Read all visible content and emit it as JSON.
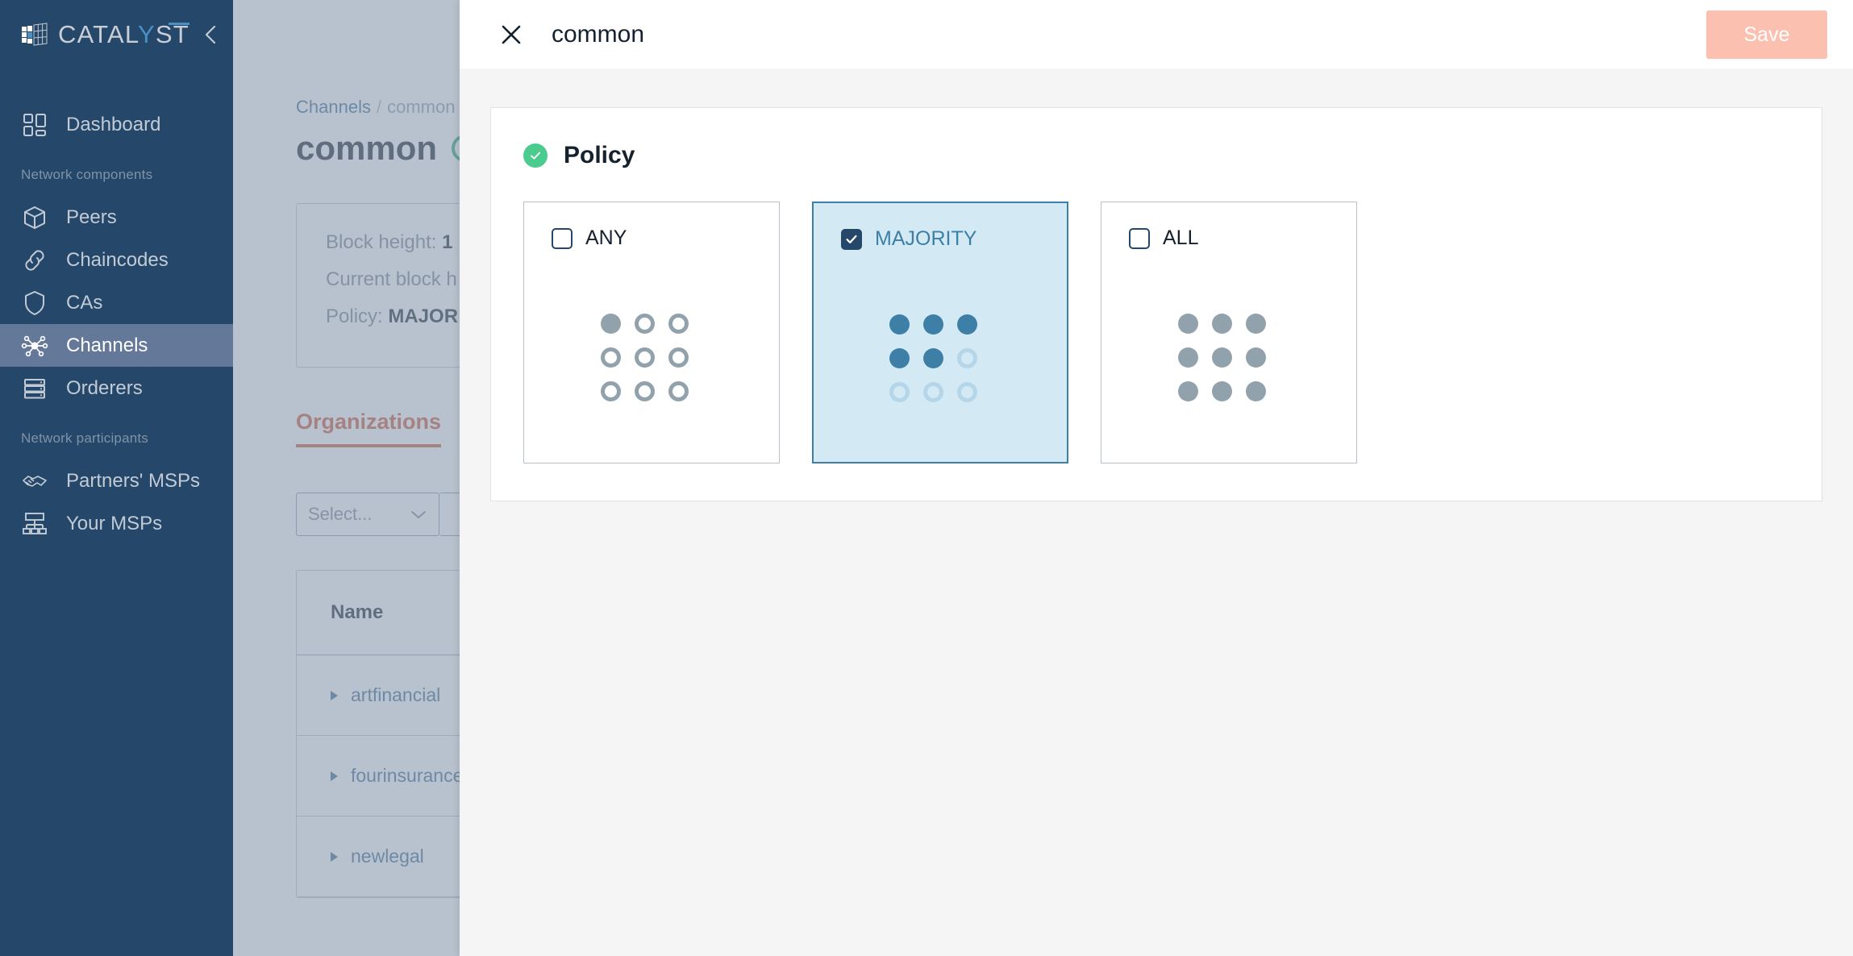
{
  "brand": {
    "name_prefix": "CATAL",
    "name_accent": "Y",
    "name_suffix": "ST",
    "logo_icon": "cube-grid-icon",
    "collapse_icon": "chevron-left-icon",
    "sidebar_bg": "#254769"
  },
  "sidebar": {
    "primary": [
      {
        "label": "Dashboard",
        "icon": "dashboard-grid-icon",
        "active": false
      }
    ],
    "sections": [
      {
        "label": "Network components",
        "items": [
          {
            "label": "Peers",
            "icon": "cube-icon",
            "active": false
          },
          {
            "label": "Chaincodes",
            "icon": "link-chain-icon",
            "active": false
          },
          {
            "label": "CAs",
            "icon": "shield-icon",
            "active": false
          },
          {
            "label": "Channels",
            "icon": "network-nodes-icon",
            "active": true
          },
          {
            "label": "Orderers",
            "icon": "server-stack-icon",
            "active": false
          }
        ]
      },
      {
        "label": "Network participants",
        "items": [
          {
            "label": "Partners' MSPs",
            "icon": "handshake-icon",
            "active": false
          },
          {
            "label": "Your MSPs",
            "icon": "org-chart-icon",
            "active": false
          }
        ]
      }
    ]
  },
  "background_page": {
    "breadcrumb": {
      "root": "Channels",
      "separator": "/",
      "current": "common"
    },
    "page_title": "common",
    "status_icon": "status-ring-green",
    "info": {
      "block_height_label": "Block height:",
      "block_height_value": "1",
      "current_block_label": "Current block h",
      "policy_label": "Policy:",
      "policy_value": "MAJOR"
    },
    "tabs": [
      {
        "label": "Organizations",
        "active": true
      }
    ],
    "filter": {
      "select_placeholder": "Select...",
      "chevron_icon": "chevron-down-icon"
    },
    "table": {
      "columns": [
        "Name"
      ],
      "rows": [
        {
          "name": "artfinancial",
          "expand_icon": "caret-right-icon"
        },
        {
          "name": "fourinsurance",
          "expand_icon": "caret-right-icon"
        },
        {
          "name": "newlegal",
          "expand_icon": "caret-right-icon"
        }
      ]
    }
  },
  "modal": {
    "close_icon": "close-x-icon",
    "title": "common",
    "save_label": "Save",
    "save_color": "#fbc0b0",
    "policy_section": {
      "status_icon": "check-circle-green-icon",
      "status_color": "#4ccb8e",
      "title": "Policy",
      "options": [
        {
          "label": "ANY",
          "selected": false,
          "checkbox_icon": "checkbox-unchecked-icon",
          "dot_pattern": [
            "fill-gray",
            "ring-gray",
            "ring-gray",
            "ring-gray",
            "ring-gray",
            "ring-gray",
            "ring-gray",
            "ring-gray",
            "ring-gray"
          ]
        },
        {
          "label": "MAJORITY",
          "selected": true,
          "checkbox_icon": "checkbox-checked-icon",
          "dot_pattern": [
            "fill-blue",
            "fill-blue",
            "fill-blue",
            "fill-blue",
            "fill-blue",
            "ring-blue",
            "ring-blue",
            "ring-blue",
            "ring-blue"
          ]
        },
        {
          "label": "ALL",
          "selected": false,
          "checkbox_icon": "checkbox-unchecked-icon",
          "dot_pattern": [
            "fill-gray",
            "fill-gray",
            "fill-gray",
            "fill-gray",
            "fill-gray",
            "fill-gray",
            "fill-gray",
            "fill-gray",
            "fill-gray"
          ]
        }
      ]
    }
  }
}
